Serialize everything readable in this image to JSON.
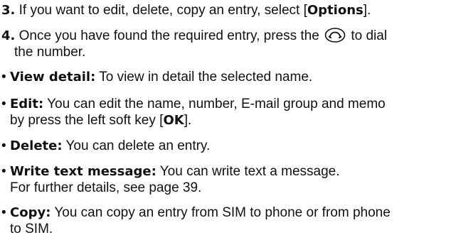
{
  "steps": [
    {
      "number": "3.",
      "text_before": " If you want to edit, delete, copy an entry, select [",
      "bold": "Options",
      "text_after": "]."
    },
    {
      "number": "4.",
      "text_before": " Once you have found the required entry, press the ",
      "icon": "send-key-icon",
      "text_after": " to dial",
      "line2": "the number."
    }
  ],
  "options": [
    {
      "bullet": "•",
      "term": "View detail:",
      "text": " To view in detail the selected name."
    },
    {
      "bullet": "•",
      "term": "Edit:",
      "text": " You can edit the name, number, E-mail group and memo",
      "line2_before": "by press the left soft key [",
      "line2_bold": "OK",
      "line2_after": "]."
    },
    {
      "bullet": "•",
      "term": "Delete:",
      "text": " You can delete an entry."
    },
    {
      "bullet": "•",
      "term": "Write text message:",
      "text": " You can write text a message.",
      "line2": "For further details, see page 39."
    },
    {
      "bullet": "•",
      "term": "Copy:",
      "text": " You can copy an entry from SIM to phone or from phone",
      "line2": "to SIM."
    }
  ]
}
